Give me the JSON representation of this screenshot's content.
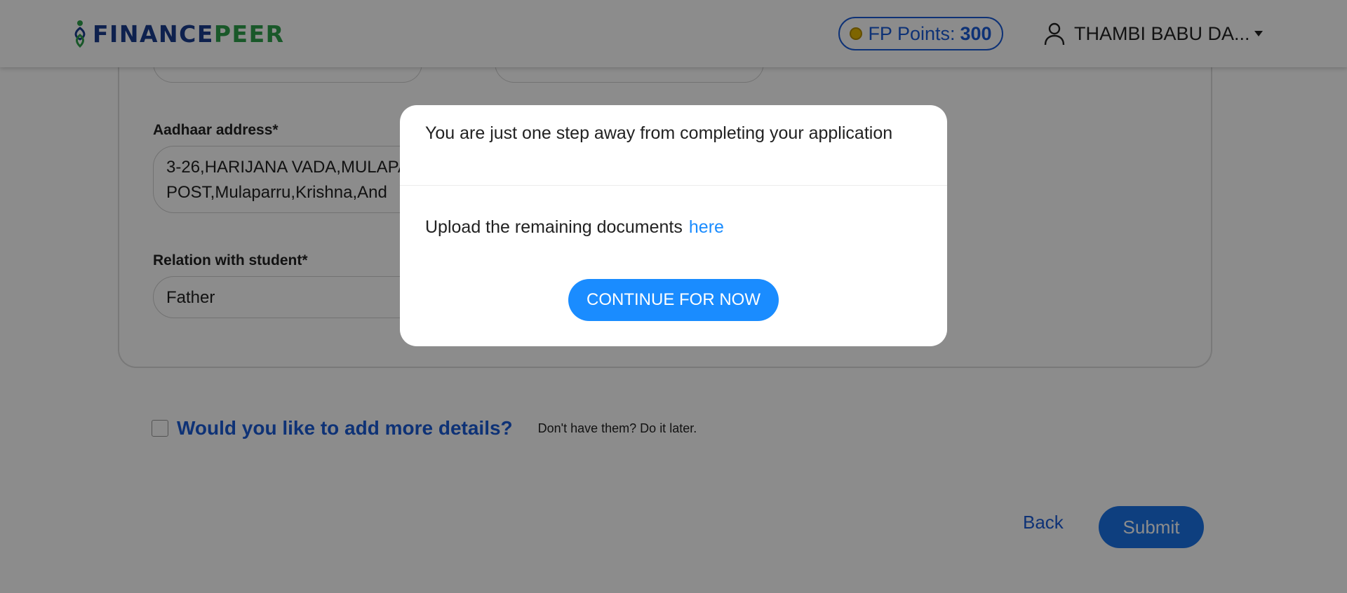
{
  "header": {
    "logo_part1": "FINANCE",
    "logo_part2": "PEER",
    "points_label": "FP Points:",
    "points_value": "300",
    "user_name": "THAMBI BABU DA..."
  },
  "form": {
    "aadhaar_label": "Aadhaar address*",
    "aadhaar_value_line1": "3-26,HARIJANA VADA,MULAPA",
    "aadhaar_value_line2": "POST,Mulaparru,Krishna,And",
    "relation_label": "Relation with student*",
    "relation_value": "Father"
  },
  "more_details": {
    "question": "Would you like to add more details?",
    "hint": "Don't have them? Do it later."
  },
  "actions": {
    "back_label": "Back",
    "submit_label": "Submit"
  },
  "modal": {
    "title": "You are just one step away from completing your application",
    "body_text": "Upload the remaining documents",
    "link_text": "here",
    "button_label": "CONTINUE FOR NOW"
  },
  "colors": {
    "brand_blue": "#1b3d8f",
    "brand_green": "#2ea04c",
    "accent_blue": "#1a8cff",
    "link_blue": "#1a5bd8"
  }
}
